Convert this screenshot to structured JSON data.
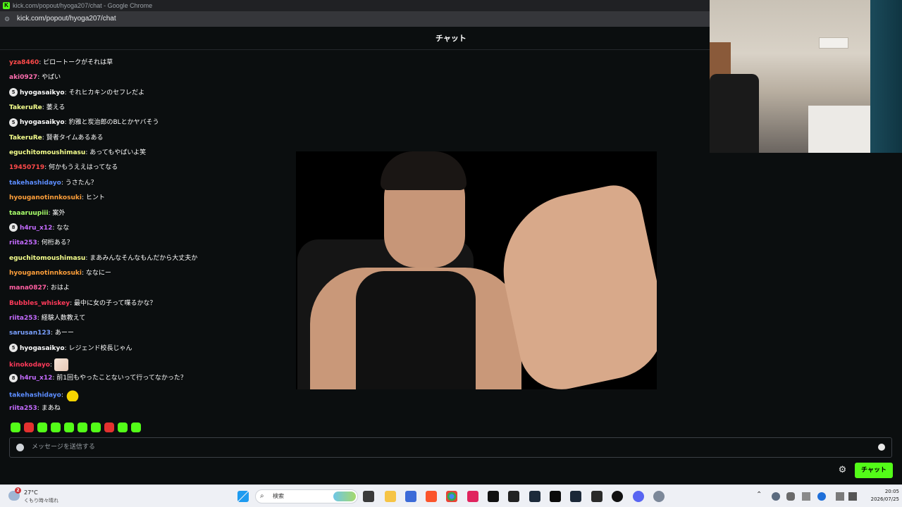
{
  "browser": {
    "window_title": "kick.com/popout/hyoga207/chat - Google Chrome",
    "url": "kick.com/popout/hyoga207/chat"
  },
  "chat": {
    "header_title": "チャット",
    "messages": [
      {
        "user": "yza8460",
        "color": "#ff4a4a",
        "text": "ピロートークがそれは草",
        "badge": ""
      },
      {
        "user": "aki0927",
        "color": "#ff6fb1",
        "text": "やばい",
        "badge": ""
      },
      {
        "user": "hyogasaikyo",
        "color": "#ffffff",
        "text": "それヒカキンのセフレだよ",
        "badge": "5"
      },
      {
        "user": "TakeruRe",
        "color": "#f5ff8c",
        "text": "萎える",
        "badge": ""
      },
      {
        "user": "hyogasaikyo",
        "color": "#ffffff",
        "text": "豹雅と炭治郎のBLとかヤバそう",
        "badge": "5"
      },
      {
        "user": "TakeruRe",
        "color": "#f5ff8c",
        "text": "賢者タイムあるある",
        "badge": ""
      },
      {
        "user": "eguchitomoushimasu",
        "color": "#f5ff8c",
        "text": "あってもやばいよ笑",
        "badge": ""
      },
      {
        "user": "19450719",
        "color": "#ff4a4a",
        "text": "何かもうええはってなる",
        "badge": ""
      },
      {
        "user": "takehashidayo",
        "color": "#5c8dff",
        "text": "うさたん？",
        "badge": ""
      },
      {
        "user": "hyouganotinnkosuki",
        "color": "#ff9f3a",
        "text": "ヒント",
        "badge": ""
      },
      {
        "user": "taaaruupiii",
        "color": "#a8ff6b",
        "text": "案外",
        "badge": ""
      },
      {
        "user": "h4ru_x12",
        "color": "#c46bff",
        "text": "なな",
        "badge": "8"
      },
      {
        "user": "riita253",
        "color": "#c46bff",
        "text": "何桁ある？",
        "badge": ""
      },
      {
        "user": "eguchitomoushimasu",
        "color": "#f5ff8c",
        "text": "まあみんなそんなもんだから大丈夫か",
        "badge": ""
      },
      {
        "user": "hyouganotinnkosuki",
        "color": "#ff9f3a",
        "text": "ななにー",
        "badge": ""
      },
      {
        "user": "mana0827",
        "color": "#ff5fa2",
        "text": "おはよ",
        "badge": ""
      },
      {
        "user": "Bubbles_whiskey",
        "color": "#ff3a5a",
        "text": "最中に女の子って喋るかな？",
        "badge": ""
      },
      {
        "user": "riita253",
        "color": "#c46bff",
        "text": "経験人数教えて",
        "badge": ""
      },
      {
        "user": "sarusan123",
        "color": "#7aa0ff",
        "text": "あーー",
        "badge": ""
      },
      {
        "user": "hyogasaikyo",
        "color": "#ffffff",
        "text": "レジェンド校長じゃん",
        "badge": "5"
      },
      {
        "user": "kinokodayo",
        "color": "#ff3a5a",
        "text": "",
        "badge": "",
        "emote": "emote-cat"
      },
      {
        "user": "h4ru_x12",
        "color": "#c46bff",
        "text": "前1回もやったことないって行ってなかった？",
        "badge": "8"
      },
      {
        "user": "takehashidayo",
        "color": "#5c8dff",
        "text": "",
        "badge": "",
        "emote": "emote-duck"
      },
      {
        "user": "riita253",
        "color": "#c46bff",
        "text": "まあね",
        "badge": ""
      }
    ],
    "input_placeholder": "メッセージを送信する",
    "send_button": "チャット",
    "accent_color": "#53fc18"
  },
  "taskbar": {
    "weather_temp": "27°C",
    "weather_condition": "くもり時々晴れ",
    "weather_alert_count": "2",
    "search_label": "検索",
    "clock_time": "20:05",
    "clock_date": "2026/07/25"
  }
}
